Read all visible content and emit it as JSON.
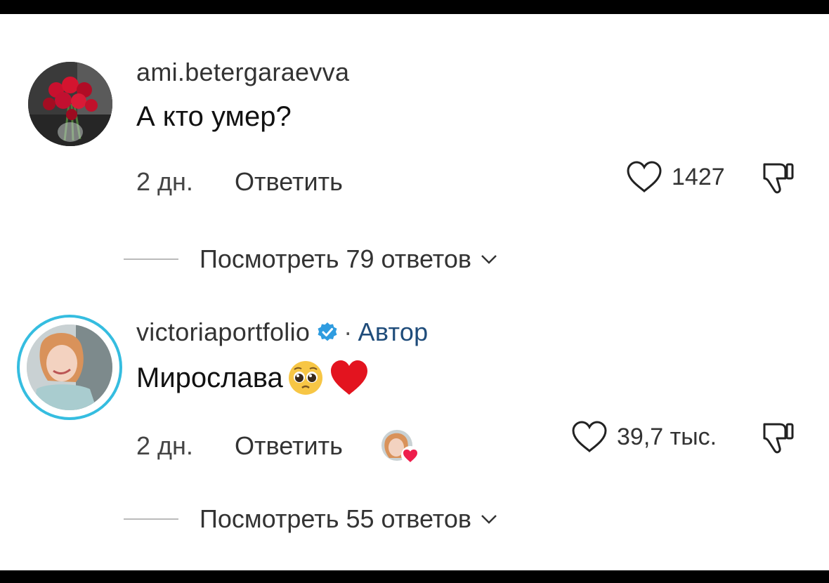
{
  "comments": [
    {
      "username": "ami.betergaraevva",
      "text": "А кто умер?",
      "time": "2 дн.",
      "reply_label": "Ответить",
      "likes": "1427",
      "view_replies": "Посмотреть 79 ответов",
      "avatar_icon": "roses-photo"
    },
    {
      "username": "victoriaportfolio",
      "verified": true,
      "author_sep": "·",
      "author_label": "Автор",
      "text": "Мирослава",
      "emoji": [
        "pleading-face-emoji",
        "red-heart-emoji"
      ],
      "time": "2 дн.",
      "reply_label": "Ответить",
      "liked_by_author": true,
      "likes": "39,7 тыс.",
      "view_replies": "Посмотреть 55 ответов",
      "avatar_icon": "woman-portrait-photo",
      "story_ring_color": "#35bde0"
    }
  ]
}
